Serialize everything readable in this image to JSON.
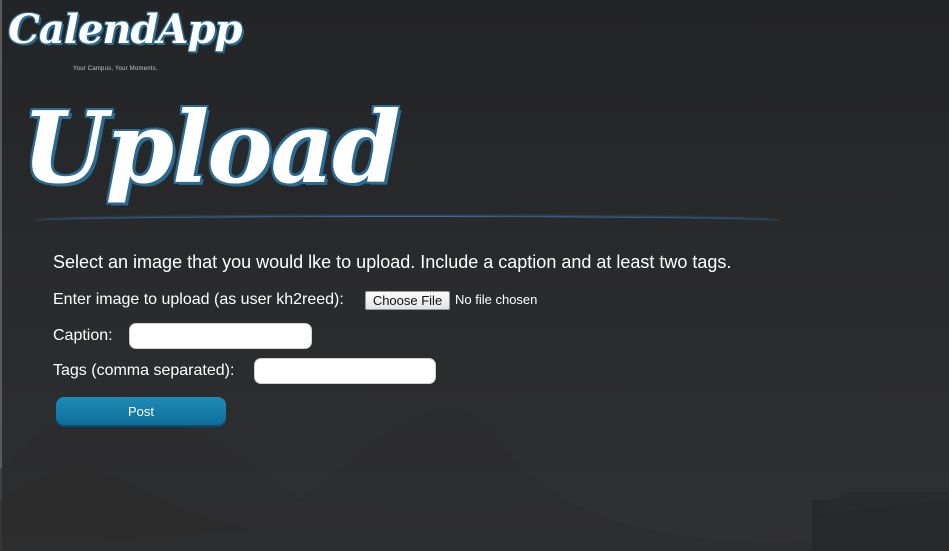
{
  "app": {
    "logo_text": "CalendApp",
    "tagline": "Your Campus, Your Moments."
  },
  "page": {
    "heading": "Upload",
    "instructions": "Select an image that you would lke to upload. Include a caption and at least two tags."
  },
  "form": {
    "file_label": "Enter image to upload (as user kh2reed):",
    "choose_file_label": "Choose File",
    "file_status": "No file chosen",
    "caption_label": "Caption:",
    "caption_value": "",
    "tags_label": "Tags (comma separated):",
    "tags_value": "",
    "post_label": "Post"
  },
  "colors": {
    "accent": "#0f76a3",
    "heading_outline": "#2a6b92",
    "background": "#26272a"
  }
}
